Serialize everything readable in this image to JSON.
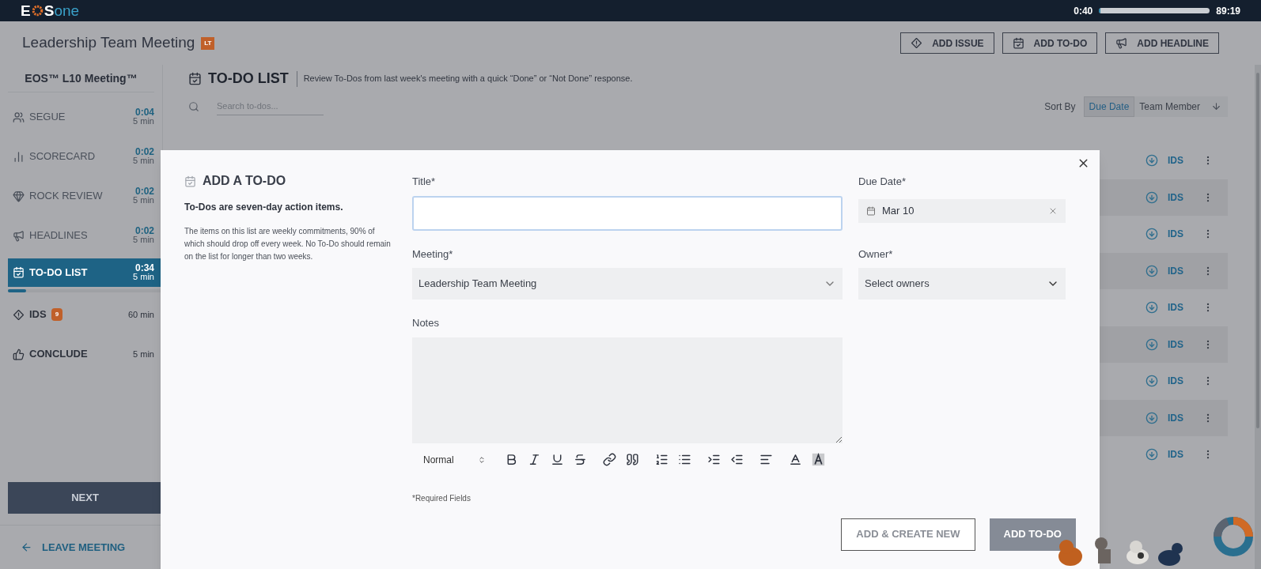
{
  "top_bar": {
    "logo": {
      "lead": "E",
      "tail": "S",
      "suffix": "one"
    },
    "timer": {
      "elapsed": "0:40",
      "level": 0.01,
      "remaining": "89:19"
    }
  },
  "header": {
    "title": "Leadership Team Meeting",
    "badge": "LT",
    "actions": [
      {
        "label": "ADD ISSUE"
      },
      {
        "label": "ADD TO-DO"
      },
      {
        "label": "ADD HEADLINE"
      }
    ]
  },
  "sidebar": {
    "title": "EOS™ L10 Meeting™",
    "items": [
      {
        "label": "SEGUE",
        "elapsed": "0:04",
        "duration": "5 min",
        "selected": false
      },
      {
        "label": "SCORECARD",
        "elapsed": "0:02",
        "duration": "5 min",
        "selected": false
      },
      {
        "label": "ROCK REVIEW",
        "elapsed": "0:02",
        "duration": "5 min",
        "selected": false
      },
      {
        "label": "HEADLINES",
        "elapsed": "0:02",
        "duration": "5 min",
        "selected": false
      },
      {
        "label": "TO-DO LIST",
        "elapsed": "0:34",
        "duration": "5 min",
        "selected": true,
        "level": 0.12
      },
      {
        "label": "IDS",
        "badge": "9",
        "duration": "60 min",
        "selected": false
      },
      {
        "label": "CONCLUDE",
        "duration": "5 min",
        "selected": false
      }
    ],
    "next_button": "NEXT",
    "leave_button": "LEAVE MEETING"
  },
  "main": {
    "title": "TO-DO LIST",
    "description": "Review To-Dos from last week's meeting with a quick “Done” or “Not Done” response.",
    "search": {
      "placeholder": "Search to-dos..."
    },
    "sort": {
      "label": "Sort By",
      "options": [
        {
          "label": "Due Date",
          "selected": true
        },
        {
          "label": "Team Member",
          "selected": false
        }
      ]
    },
    "rows": [
      {
        "action": "IDS"
      },
      {
        "action": "IDS"
      },
      {
        "action": "IDS"
      },
      {
        "action": "IDS"
      },
      {
        "action": "IDS"
      },
      {
        "action": "IDS"
      },
      {
        "action": "IDS"
      },
      {
        "action": "IDS"
      },
      {
        "action": "IDS"
      }
    ]
  },
  "modal": {
    "title": "ADD A TO-DO",
    "subtitle": "To-Dos are seven-day action items.",
    "description": "The items on this list are weekly commitments, 90% of which should drop off every week. No To-Do should remain on the list for longer than two weeks.",
    "title_field": {
      "label": "Title*"
    },
    "due_date": {
      "label": "Due Date*",
      "value": "Mar 10"
    },
    "meeting": {
      "label": "Meeting*",
      "value": "Leadership Team Meeting"
    },
    "owner": {
      "label": "Owner*",
      "placeholder": "Select owners"
    },
    "notes": {
      "label": "Notes",
      "format": "Normal"
    },
    "required_note": "*Required Fields",
    "buttons": [
      {
        "label": "ADD & CREATE NEW",
        "primary": false
      },
      {
        "label": "ADD TO-DO",
        "primary": true
      }
    ]
  }
}
